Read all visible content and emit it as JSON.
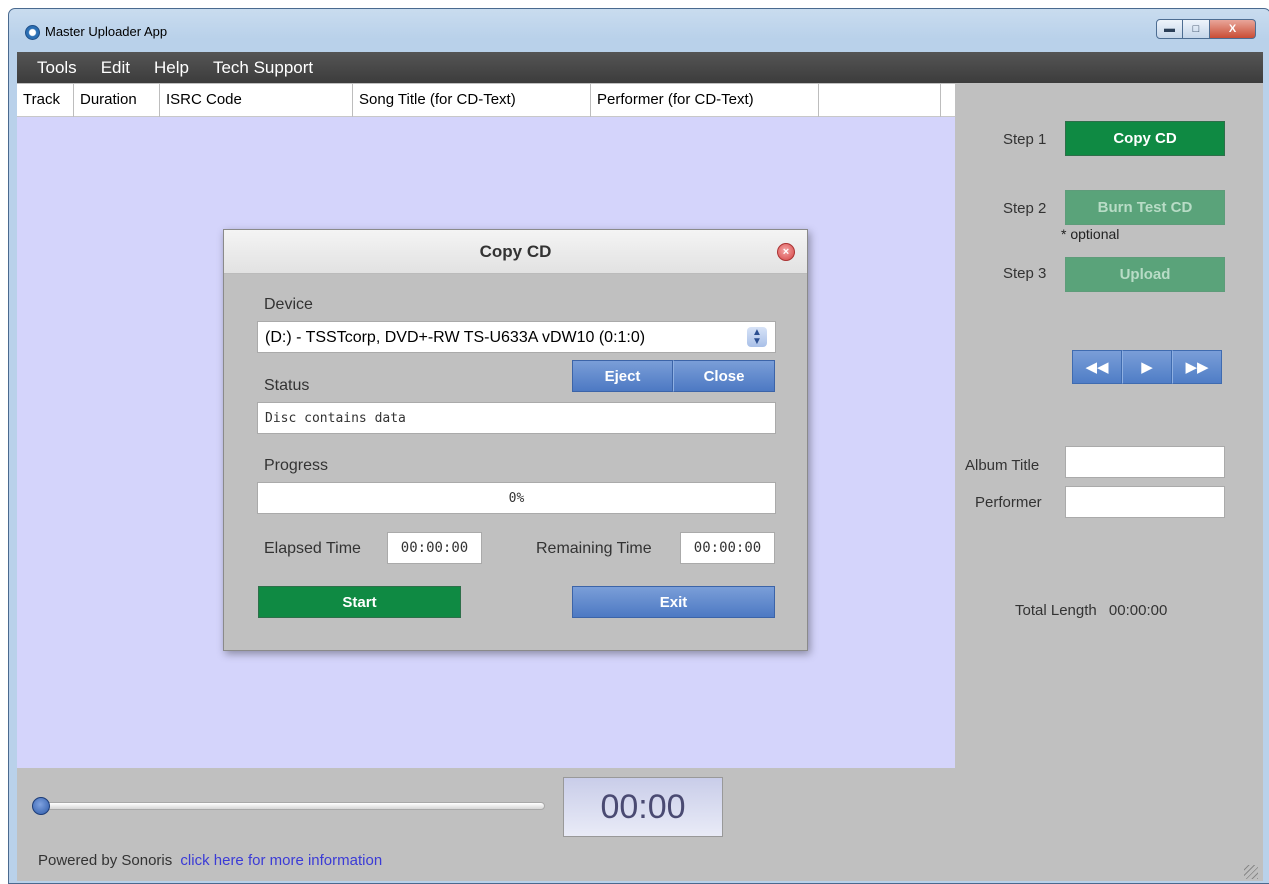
{
  "window": {
    "title": "Master Uploader App"
  },
  "menu": [
    "Tools",
    "Edit",
    "Help",
    "Tech Support"
  ],
  "table": {
    "columns": [
      "Track",
      "Duration",
      "ISRC Code",
      "Song Title (for CD-Text)",
      "Performer (for CD-Text)",
      ""
    ]
  },
  "steps": [
    {
      "label": "Step 1",
      "button": "Copy CD",
      "state": "active"
    },
    {
      "label": "Step 2",
      "button": "Burn Test CD",
      "state": "disabled",
      "note": "* optional"
    },
    {
      "label": "Step 3",
      "button": "Upload",
      "state": "disabled"
    }
  ],
  "transport": {
    "rewind": "◀◀",
    "play": "▶",
    "forward": "▶▶"
  },
  "album": {
    "title_label": "Album Title",
    "title_value": "",
    "performer_label": "Performer",
    "performer_value": ""
  },
  "total_length": {
    "label": "Total Length",
    "value": "00:00:00"
  },
  "player": {
    "time": "00:00",
    "position": 0
  },
  "footer": {
    "powered": "Powered by Sonoris",
    "link": "click here for more information"
  },
  "dialog": {
    "title": "Copy CD",
    "device_label": "Device",
    "device_value": "(D:) - TSSTcorp, DVD+-RW TS-U633A vDW10 (0:1:0)",
    "eject": "Eject",
    "close": "Close",
    "status_label": "Status",
    "status_value": "Disc contains data",
    "progress_label": "Progress",
    "progress_text": "0%",
    "progress_value": 0,
    "elapsed_label": "Elapsed Time",
    "elapsed_value": "00:00:00",
    "remaining_label": "Remaining Time",
    "remaining_value": "00:00:00",
    "start": "Start",
    "exit": "Exit"
  },
  "colors": {
    "accent_green": "#0f8a43",
    "accent_blue": "#4d79c3",
    "table_bg": "#d4d4fb"
  }
}
